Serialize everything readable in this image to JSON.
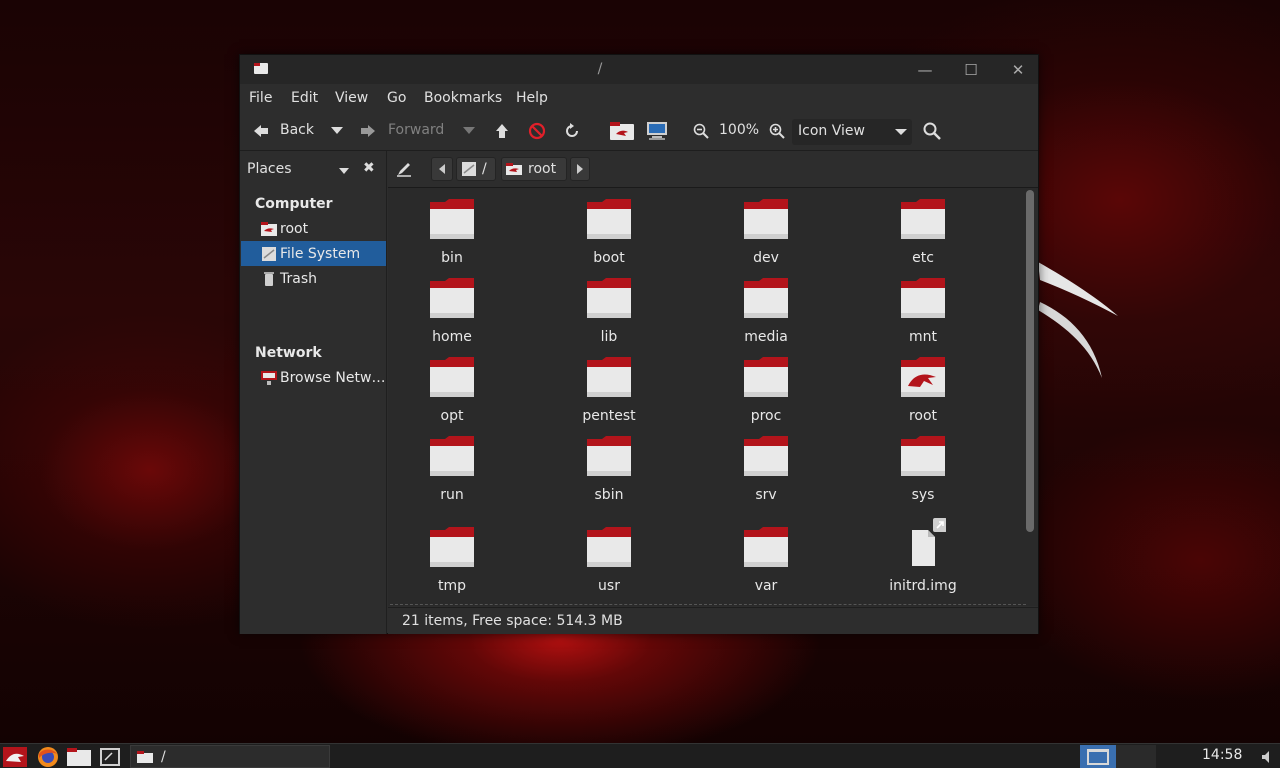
{
  "window": {
    "title": "/",
    "app_icon": "folder-icon",
    "controls": [
      "minimize",
      "maximize",
      "close"
    ]
  },
  "menubar": {
    "items": [
      "File",
      "Edit",
      "View",
      "Go",
      "Bookmarks",
      "Help"
    ]
  },
  "toolbar": {
    "back_label": "Back",
    "forward_label": "Forward",
    "zoom_level": "100%",
    "view_mode": "Icon View"
  },
  "sidebar": {
    "header": "Places",
    "sections": [
      {
        "title": "Computer",
        "items": [
          {
            "label": "root",
            "icon": "home-folder-icon"
          },
          {
            "label": "File System",
            "icon": "drive-icon",
            "active": true
          },
          {
            "label": "Trash",
            "icon": "trash-icon"
          }
        ]
      },
      {
        "title": "Network",
        "items": [
          {
            "label": "Browse Netw…",
            "icon": "network-icon"
          }
        ]
      }
    ]
  },
  "pathbar": {
    "segments": [
      "/",
      "root"
    ]
  },
  "files": [
    {
      "name": "bin",
      "type": "folder"
    },
    {
      "name": "boot",
      "type": "folder"
    },
    {
      "name": "dev",
      "type": "folder"
    },
    {
      "name": "etc",
      "type": "folder"
    },
    {
      "name": "home",
      "type": "folder"
    },
    {
      "name": "lib",
      "type": "folder"
    },
    {
      "name": "media",
      "type": "folder"
    },
    {
      "name": "mnt",
      "type": "folder"
    },
    {
      "name": "opt",
      "type": "folder"
    },
    {
      "name": "pentest",
      "type": "folder"
    },
    {
      "name": "proc",
      "type": "folder"
    },
    {
      "name": "root",
      "type": "home-folder"
    },
    {
      "name": "run",
      "type": "folder"
    },
    {
      "name": "sbin",
      "type": "folder"
    },
    {
      "name": "srv",
      "type": "folder"
    },
    {
      "name": "sys",
      "type": "folder"
    },
    {
      "name": "tmp",
      "type": "folder"
    },
    {
      "name": "usr",
      "type": "folder"
    },
    {
      "name": "var",
      "type": "folder"
    },
    {
      "name": "initrd.img",
      "type": "symlink-file"
    }
  ],
  "statusbar": {
    "text": "21 items, Free space: 514.3 MB"
  },
  "taskbar": {
    "task_title": "/",
    "clock": "14:58"
  },
  "colors": {
    "folder_red": "#b3141b",
    "folder_white": "#e9e9e9",
    "selection_blue": "#215d9c",
    "window_bg": "#2d2d2d"
  }
}
